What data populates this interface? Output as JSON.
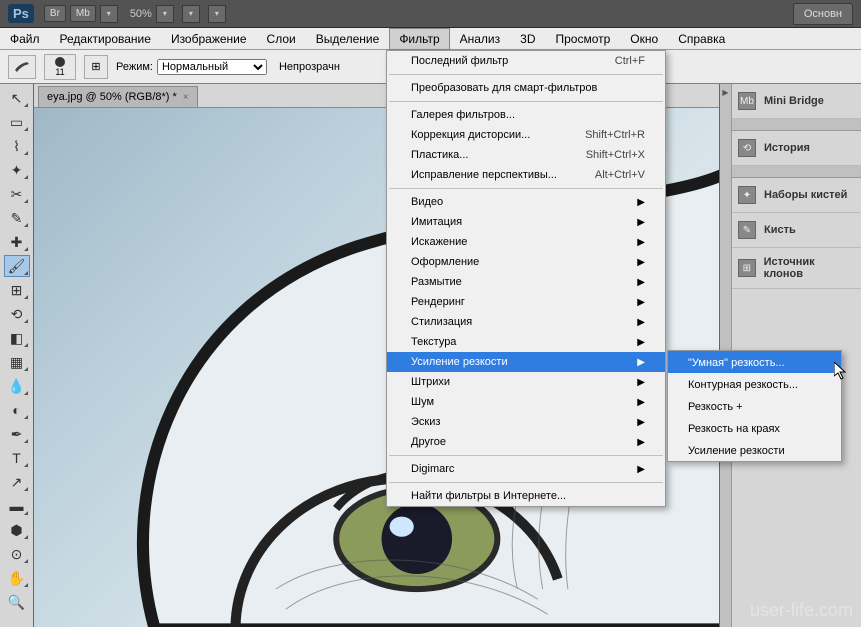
{
  "titlebar": {
    "ps": "Ps",
    "br": "Br",
    "mb": "Mb",
    "zoom": "50%",
    "tab_right": "Основн"
  },
  "menubar": [
    "Файл",
    "Редактирование",
    "Изображение",
    "Слои",
    "Выделение",
    "Фильтр",
    "Анализ",
    "3D",
    "Просмотр",
    "Окно",
    "Справка"
  ],
  "optbar": {
    "brush_size": "11",
    "mode_label": "Режим:",
    "mode_value": "Нормальный",
    "opacity_label": "Непрозрачн"
  },
  "doctab": {
    "title": "eya.jpg @ 50% (RGB/8*) *",
    "close": "×"
  },
  "rpanels": [
    {
      "icon": "Mb",
      "label": "Mini Bridge"
    },
    {
      "icon": "⟲",
      "label": "История"
    },
    {
      "icon": "✦",
      "label": "Наборы кистей"
    },
    {
      "icon": "✎",
      "label": "Кисть"
    },
    {
      "icon": "⊞",
      "label": "Источник клонов"
    }
  ],
  "menu": {
    "last": {
      "label": "Последний фильтр",
      "sc": "Ctrl+F"
    },
    "smart": "Преобразовать для смарт-фильтров",
    "gallery": "Галерея фильтров...",
    "lens": {
      "label": "Коррекция дисторсии...",
      "sc": "Shift+Ctrl+R"
    },
    "liquify": {
      "label": "Пластика...",
      "sc": "Shift+Ctrl+X"
    },
    "vanish": {
      "label": "Исправление перспективы...",
      "sc": "Alt+Ctrl+V"
    },
    "groups": [
      "Видео",
      "Имитация",
      "Искажение",
      "Оформление",
      "Размытие",
      "Рендеринг",
      "Стилизация",
      "Текстура",
      "Усиление резкости",
      "Штрихи",
      "Шум",
      "Эскиз",
      "Другое"
    ],
    "digi": "Digimarc",
    "browse": "Найти фильтры в Интернете..."
  },
  "submenu": [
    "\"Умная\" резкость...",
    "Контурная резкость...",
    "Резкость +",
    "Резкость на краях",
    "Усиление резкости"
  ],
  "watermark": "user-life.com"
}
